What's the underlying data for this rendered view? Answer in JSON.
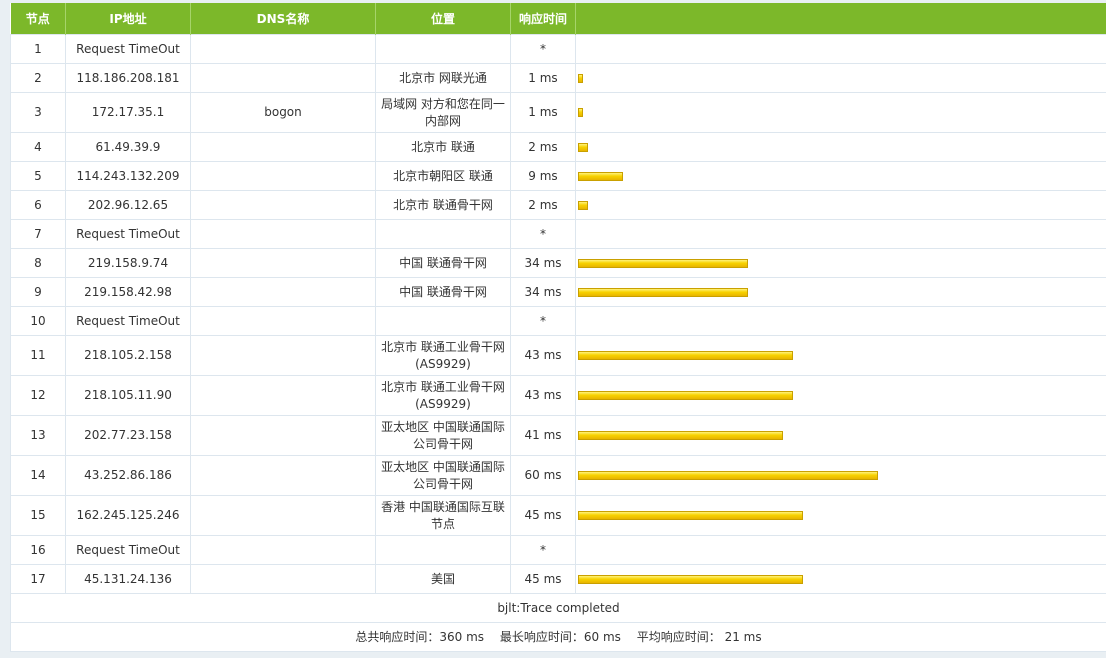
{
  "headers": [
    "节点",
    "IP地址",
    "DNS名称",
    "位置",
    "响应时间",
    ""
  ],
  "max_ms": 60,
  "rows": [
    {
      "hop": "1",
      "ip": "Request TimeOut",
      "dns": "",
      "loc": "",
      "time": "*",
      "ms": 0
    },
    {
      "hop": "2",
      "ip": "118.186.208.181",
      "dns": "",
      "loc": "北京市 网联光通",
      "time": "1 ms",
      "ms": 1
    },
    {
      "hop": "3",
      "ip": "172.17.35.1",
      "dns": "bogon",
      "loc": "局域网 对方和您在同一内部网",
      "time": "1 ms",
      "ms": 1
    },
    {
      "hop": "4",
      "ip": "61.49.39.9",
      "dns": "",
      "loc": "北京市 联通",
      "time": "2 ms",
      "ms": 2
    },
    {
      "hop": "5",
      "ip": "114.243.132.209",
      "dns": "",
      "loc": "北京市朝阳区 联通",
      "time": "9 ms",
      "ms": 9
    },
    {
      "hop": "6",
      "ip": "202.96.12.65",
      "dns": "",
      "loc": "北京市 联通骨干网",
      "time": "2 ms",
      "ms": 2
    },
    {
      "hop": "7",
      "ip": "Request TimeOut",
      "dns": "",
      "loc": "",
      "time": "*",
      "ms": 0
    },
    {
      "hop": "8",
      "ip": "219.158.9.74",
      "dns": "",
      "loc": "中国 联通骨干网",
      "time": "34 ms",
      "ms": 34
    },
    {
      "hop": "9",
      "ip": "219.158.42.98",
      "dns": "",
      "loc": "中国 联通骨干网",
      "time": "34 ms",
      "ms": 34
    },
    {
      "hop": "10",
      "ip": "Request TimeOut",
      "dns": "",
      "loc": "",
      "time": "*",
      "ms": 0
    },
    {
      "hop": "11",
      "ip": "218.105.2.158",
      "dns": "",
      "loc": "北京市 联通工业骨干网(AS9929)",
      "time": "43 ms",
      "ms": 43
    },
    {
      "hop": "12",
      "ip": "218.105.11.90",
      "dns": "",
      "loc": "北京市 联通工业骨干网(AS9929)",
      "time": "43 ms",
      "ms": 43
    },
    {
      "hop": "13",
      "ip": "202.77.23.158",
      "dns": "",
      "loc": "亚太地区 中国联通国际公司骨干网",
      "time": "41 ms",
      "ms": 41
    },
    {
      "hop": "14",
      "ip": "43.252.86.186",
      "dns": "",
      "loc": "亚太地区 中国联通国际公司骨干网",
      "time": "60 ms",
      "ms": 60
    },
    {
      "hop": "15",
      "ip": "162.245.125.246",
      "dns": "",
      "loc": "香港 中国联通国际互联节点",
      "time": "45 ms",
      "ms": 45
    },
    {
      "hop": "16",
      "ip": "Request TimeOut",
      "dns": "",
      "loc": "",
      "time": "*",
      "ms": 0
    },
    {
      "hop": "17",
      "ip": "45.131.24.136",
      "dns": "",
      "loc": "美国",
      "time": "45 ms",
      "ms": 45
    }
  ],
  "footer": {
    "completed": "bjlt:Trace completed",
    "total": "总共响应时间：360 ms",
    "max": "最长响应时间：60 ms",
    "avg": "平均响应时间： 21 ms"
  }
}
